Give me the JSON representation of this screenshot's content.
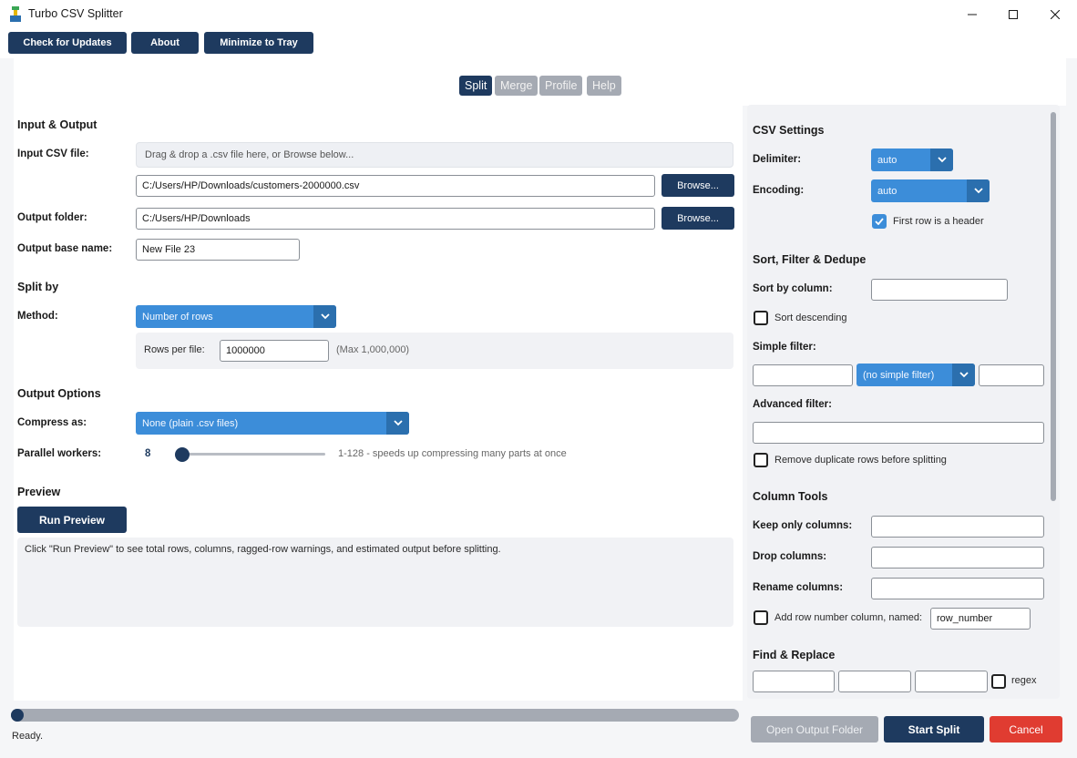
{
  "window": {
    "title": "Turbo CSV Splitter"
  },
  "toolbar": {
    "check_updates": "Check for Updates",
    "about": "About",
    "minimize_tray": "Minimize to Tray"
  },
  "tabs": [
    {
      "label": "Split",
      "active": true
    },
    {
      "label": "Merge",
      "active": false
    },
    {
      "label": "Profile",
      "active": false
    },
    {
      "label": "Help",
      "active": false
    }
  ],
  "input_output": {
    "section_title": "Input & Output",
    "input_label": "Input CSV file:",
    "dropzone_text": "Drag & drop a .csv file here, or Browse below...",
    "input_value": "C:/Users/HP/Downloads/customers-2000000.csv",
    "browse_label": "Browse...",
    "output_folder_label": "Output folder:",
    "output_folder_value": "C:/Users/HP/Downloads",
    "output_browse_label": "Browse...",
    "base_name_label": "Output base name:",
    "base_name_value": "New File 23"
  },
  "split_by": {
    "section_title": "Split by",
    "method_label": "Method:",
    "method_value": "Number of rows",
    "rows_per_file_label": "Rows per file:",
    "rows_per_file_value": "1000000",
    "rows_hint": "(Max 1,000,000)"
  },
  "output_options": {
    "section_title": "Output Options",
    "compress_label": "Compress as:",
    "compress_value": "None (plain .csv files)",
    "workers_label": "Parallel workers:",
    "workers_value": "8",
    "workers_level": 8,
    "workers_hint": "1-128 - speeds up compressing many parts at once"
  },
  "preview": {
    "section_title": "Preview",
    "run_label": "Run Preview",
    "info_text": "Click \"Run Preview\" to see total rows, columns, ragged-row warnings, and estimated output before splitting."
  },
  "csv_settings": {
    "section_title": "CSV Settings",
    "delimiter_label": "Delimiter:",
    "delimiter_value": "auto",
    "encoding_label": "Encoding:",
    "encoding_value": "auto",
    "header_label": "First row is a header",
    "header_checked": true
  },
  "sort_filter": {
    "section_title": "Sort, Filter & Dedupe",
    "sort_by_label": "Sort by column:",
    "sort_by_value": "",
    "sort_desc_label": "Sort descending",
    "simple_filter_label": "Simple filter:",
    "simple_filter_op": "(no simple filter)",
    "advanced_filter_label": "Advanced filter:",
    "dedupe_label": "Remove duplicate rows before splitting"
  },
  "column_tools": {
    "section_title": "Column Tools",
    "keep_label": "Keep only columns:",
    "drop_label": "Drop columns:",
    "rename_label": "Rename columns:",
    "row_number_label": "Add row number column, named:",
    "row_number_value": "row_number"
  },
  "find_replace": {
    "section_title": "Find & Replace",
    "regex_label": "regex"
  },
  "status": {
    "text": "Ready.",
    "progress": 0
  },
  "actions": {
    "open_folder": "Open Output Folder",
    "start": "Start Split",
    "cancel": "Cancel"
  },
  "colors": {
    "navy": "#1e3a5f",
    "accent_blue": "#3c8dd9",
    "cancel_red": "#e03c31",
    "disabled_gray": "#a5aab3"
  }
}
